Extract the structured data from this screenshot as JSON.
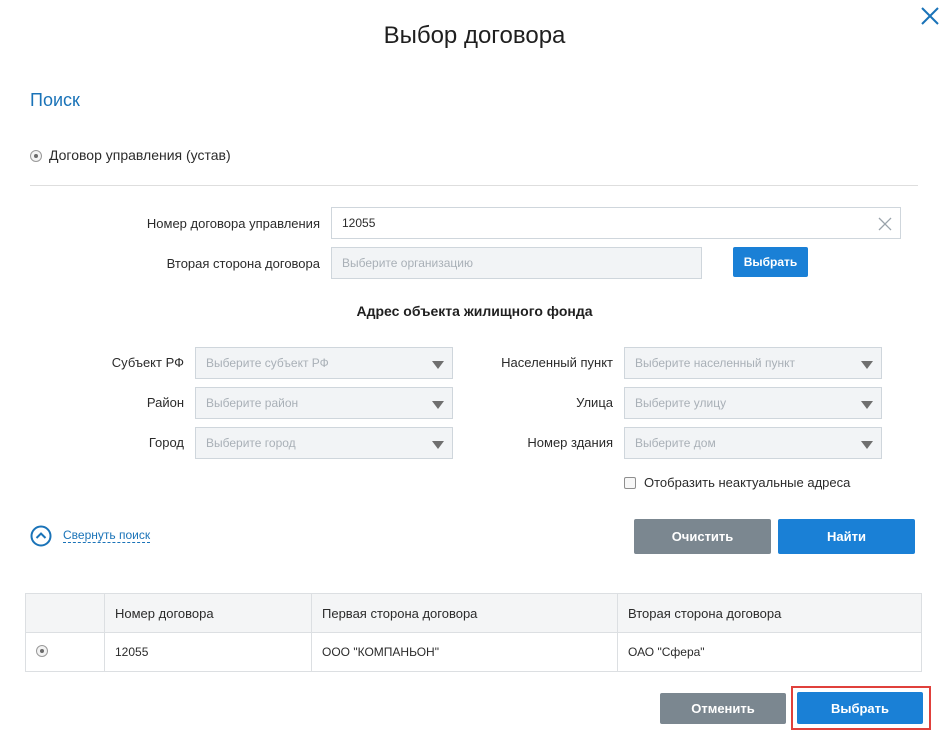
{
  "dialog": {
    "title": "Выбор договора"
  },
  "search": {
    "section_title": "Поиск",
    "contract_type_label": "Договор управления (устав)",
    "contract_number_label": "Номер договора управления",
    "contract_number_value": "12055",
    "second_party_label": "Вторая сторона договора",
    "second_party_placeholder": "Выберите организацию",
    "select_org_button": "Выбрать",
    "address_heading": "Адрес объекта жилищного фонда",
    "address": {
      "subject_label": "Субъект РФ",
      "subject_placeholder": "Выберите субъект РФ",
      "district_label": "Район",
      "district_placeholder": "Выберите район",
      "city_label": "Город",
      "city_placeholder": "Выберите город",
      "settlement_label": "Населенный пункт",
      "settlement_placeholder": "Выберите населенный пункт",
      "street_label": "Улица",
      "street_placeholder": "Выберите улицу",
      "building_label": "Номер здания",
      "building_placeholder": "Выберите дом"
    },
    "show_inactive_label": "Отобразить неактуальные адреса",
    "collapse_label": "Свернуть поиск",
    "clear_button": "Очистить",
    "find_button": "Найти"
  },
  "results": {
    "columns": [
      "Номер договора",
      "Первая сторона договора",
      "Вторая сторона договора"
    ],
    "rows": [
      [
        "12055",
        "ООО \"КОМПАНЬОН\"",
        "ОАО \"Сфера\""
      ]
    ]
  },
  "footer": {
    "cancel_button": "Отменить",
    "select_button": "Выбрать"
  },
  "colors": {
    "accent": "#1a80d6",
    "secondary_button": "#7b8790",
    "highlight_border": "#e0403b"
  }
}
